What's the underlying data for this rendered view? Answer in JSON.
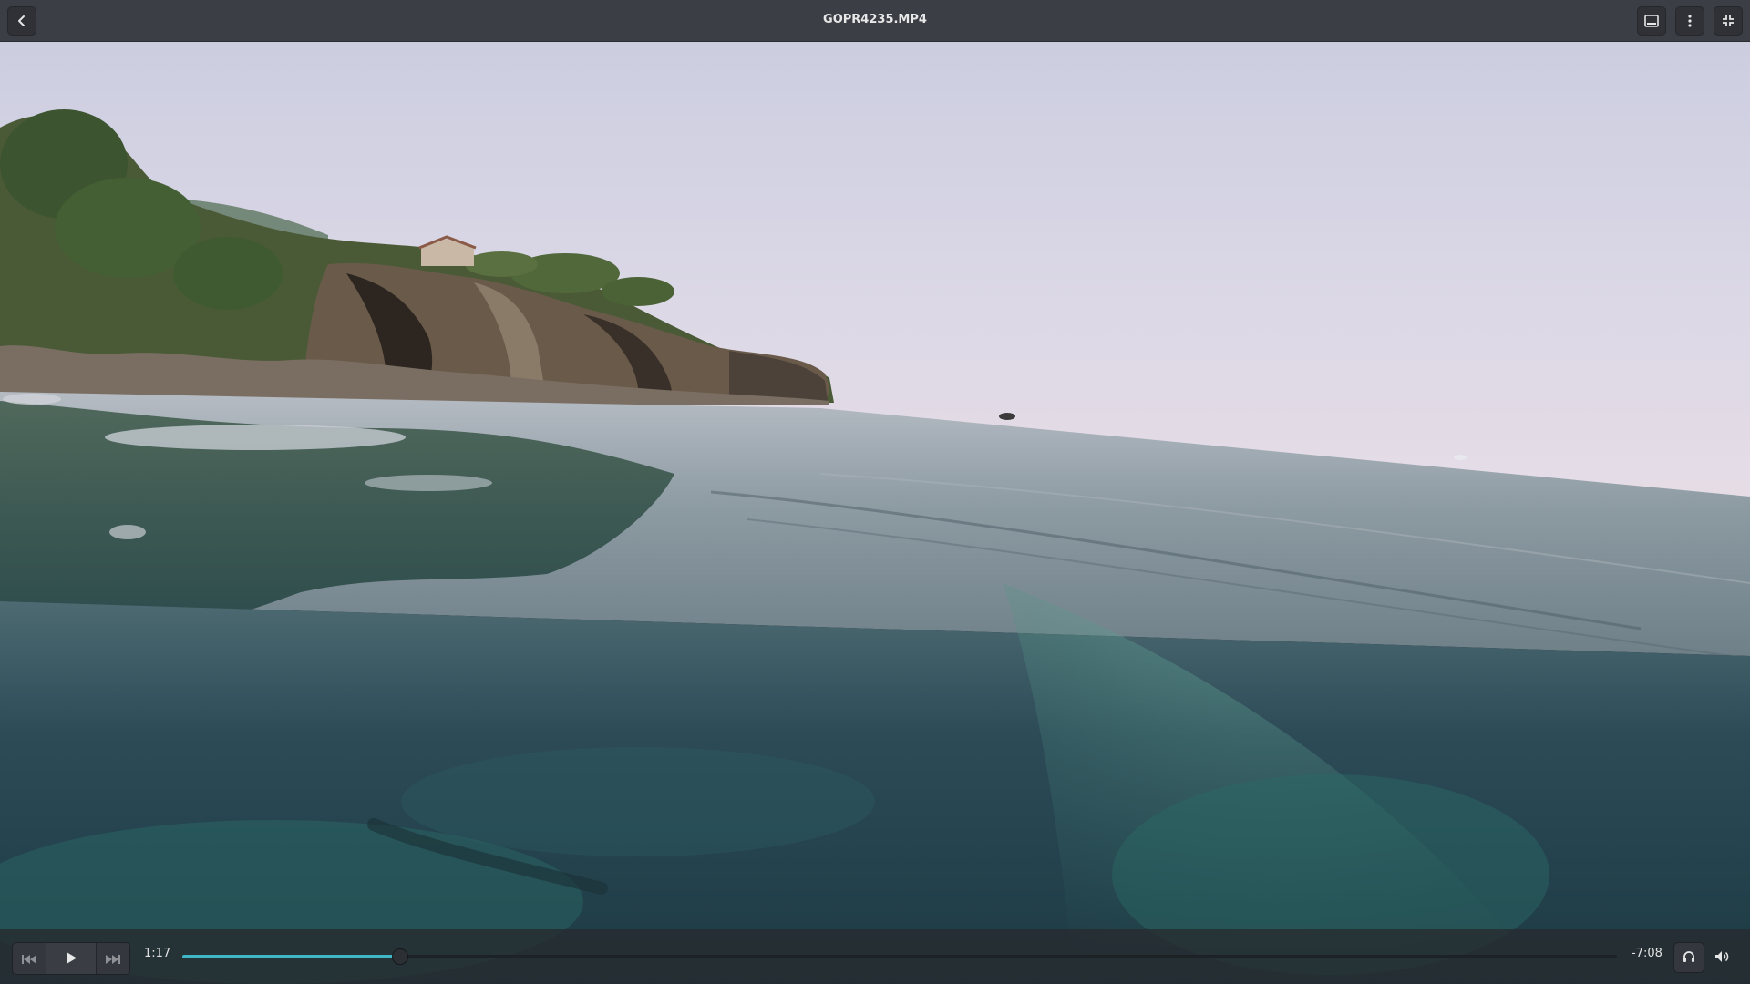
{
  "window": {
    "title": "GOPR4235.MP4"
  },
  "header": {
    "back_icon": "chevron-left-icon",
    "subtitles_icon": "subtitles-icon",
    "menu_icon": "vertical-dots-icon",
    "fullscreen_icon": "unfullscreen-icon"
  },
  "player": {
    "elapsed": "1:17",
    "remaining": "-7:08",
    "progress_fraction": 0.152,
    "accent_color": "#3fb7c6",
    "prev_icon": "skip-back-icon",
    "play_icon": "play-icon",
    "next_icon": "skip-forward-icon",
    "audio_icon": "headphones-icon",
    "volume_icon": "speaker-icon"
  }
}
